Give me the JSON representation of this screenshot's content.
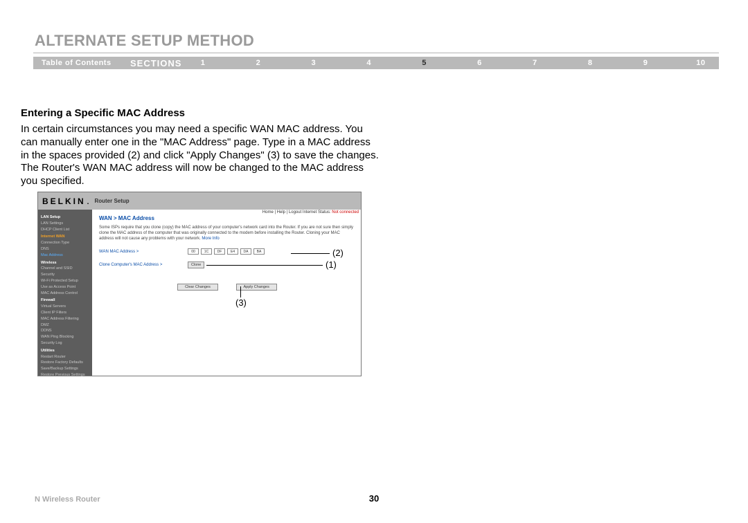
{
  "header": {
    "title": "ALTERNATE SETUP METHOD"
  },
  "nav": {
    "toc": "Table of Contents",
    "sections_label": "SECTIONS",
    "numbers": [
      "1",
      "2",
      "3",
      "4",
      "5",
      "6",
      "7",
      "8",
      "9",
      "10"
    ],
    "active_index": 4
  },
  "section": {
    "subheading": "Entering a Specific MAC Address",
    "body": "In certain circumstances you may need a specific WAN MAC address. You can manually enter one in the \"MAC Address\" page. Type in a MAC address in the spaces provided (2) and click \"Apply Changes\" (3) to save the changes. The Router's WAN MAC address will now be changed to the MAC address you specified."
  },
  "screenshot": {
    "brand": "BELKIN",
    "brand_sub": "Router Setup",
    "top_links": "Home | Help | Logout  Internet Status:",
    "status_red": "Not connected",
    "crumb": "WAN > MAC Address",
    "description_1": "Some ISPs require that you clone (copy) the MAC address of your computer's network card into the Router. If you are not sure then simply clone the MAC address of the computer that was originally connected to the modem before installing the Router. Cloning your MAC address will not cause any problems with your network.",
    "more_info": "More Info",
    "row1_label": "WAN MAC Address >",
    "mac": [
      "00",
      "1C",
      "DF",
      "E4",
      "DA",
      "BA"
    ],
    "row2_label": "Clone Computer's MAC Address >",
    "clone_btn": "Clone",
    "clear_btn": "Clear Changes",
    "apply_btn": "Apply Changes",
    "sidebar": {
      "s1_head": "LAN Setup",
      "s1_items": [
        "LAN Settings",
        "DHCP Client List"
      ],
      "s2_head": "Internet WAN",
      "s2_items": [
        "Connection Type",
        "DNS"
      ],
      "s2_active": "Mac Address",
      "s3_head": "Wireless",
      "s3_items": [
        "Channel and SSID",
        "Security",
        "Wi-Fi Protected Setup",
        "Use as Access Point",
        "MAC Address Control"
      ],
      "s4_head": "Firewall",
      "s4_items": [
        "Virtual Servers",
        "Client IP Filters",
        "MAC Address Filtering",
        "DMZ",
        "DDNS",
        "WAN Ping Blocking",
        "Security Log"
      ],
      "s5_head": "Utilities",
      "s5_items": [
        "Restart Router",
        "Restore Factory Defaults",
        "Save/Backup Settings",
        "Restore Previous Settings"
      ]
    }
  },
  "callouts": {
    "c1": "(1)",
    "c2": "(2)",
    "c3": "(3)"
  },
  "footer": {
    "left": "N Wireless Router",
    "page": "30"
  }
}
